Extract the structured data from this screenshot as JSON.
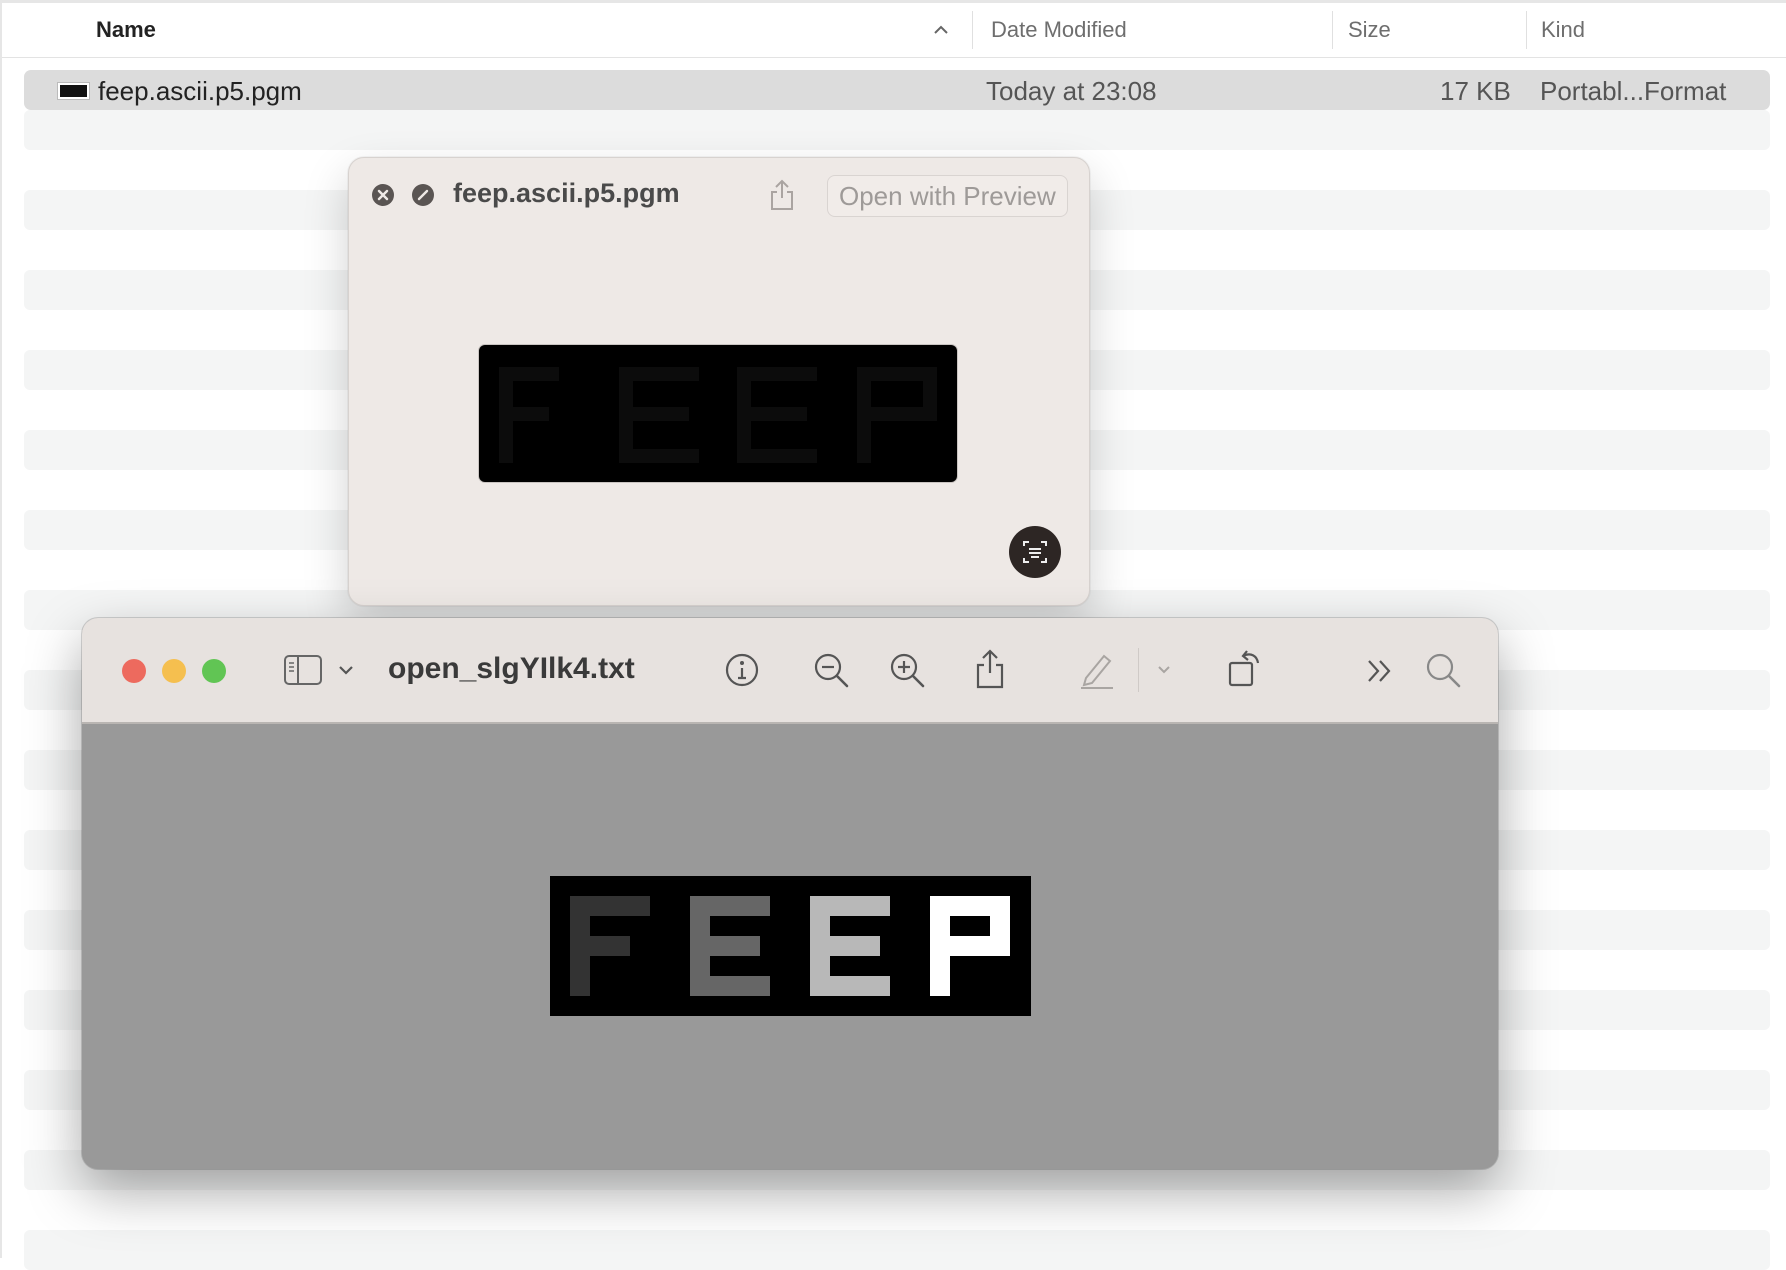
{
  "finder": {
    "columns": {
      "name": "Name",
      "date_modified": "Date Modified",
      "size": "Size",
      "kind": "Kind"
    },
    "sort_icon": "chevron-up-icon",
    "file": {
      "name": "feep.ascii.p5.pgm",
      "date_modified": "Today at 23:08",
      "size": "17 KB",
      "kind": "Portabl...Format",
      "icon": "pgm-file-icon"
    }
  },
  "quicklook": {
    "title": "feep.ascii.p5.pgm",
    "open_button": "Open with Preview",
    "icons": [
      "close-icon",
      "fullscreen-icon",
      "share-icon",
      "live-text-icon"
    ],
    "image_text": "FEEP"
  },
  "preview_window": {
    "title": "open_slgYIlk4.txt",
    "icons": [
      "sidebar-icon",
      "chevron-down-icon",
      "info-icon",
      "zoom-out-icon",
      "zoom-in-icon",
      "share-icon",
      "markup-icon",
      "chevron-down-icon",
      "rotate-icon",
      "more-icon",
      "search-icon"
    ],
    "image_text": "FEEP",
    "traffic_lights": {
      "close": "#ed6a5e",
      "minimize": "#f5bf4f",
      "zoom": "#61c554"
    }
  },
  "colors": {
    "window_bg": "#e7e2df",
    "content_bg": "#999999",
    "quicklook_bg": "#eee9e6",
    "selection": "#dcdcdc"
  }
}
